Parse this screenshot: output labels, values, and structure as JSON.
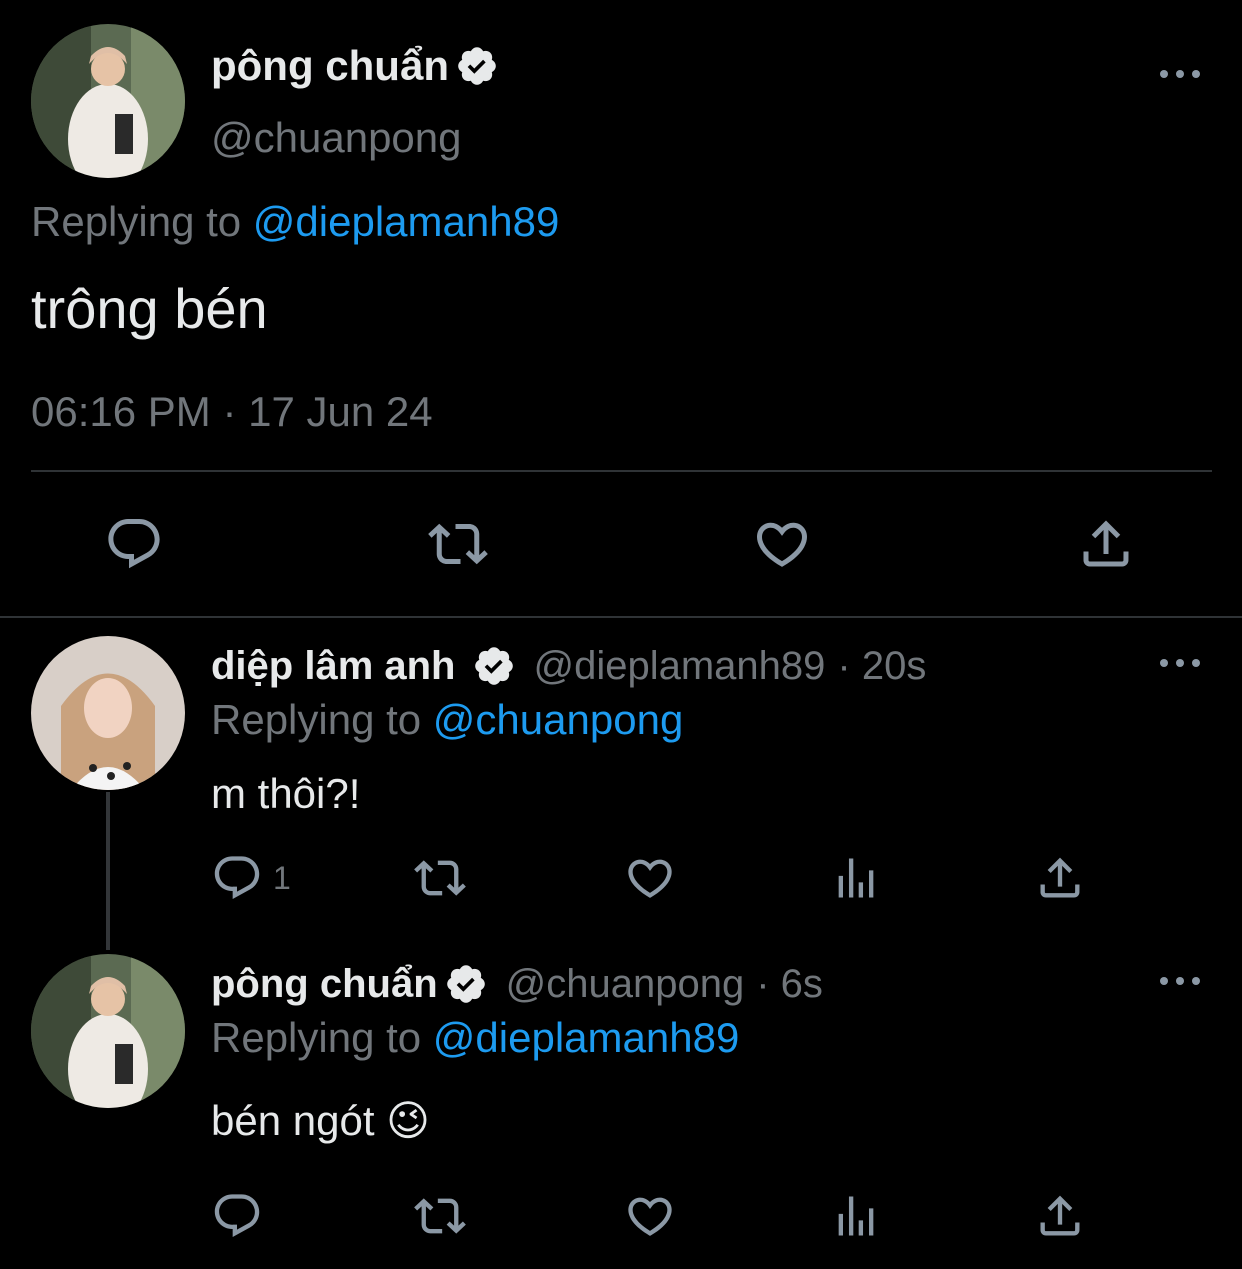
{
  "colors": {
    "background": "#000000",
    "text": "#e7e9ea",
    "muted": "#71767b",
    "link": "#1d9bf0",
    "icon": "#8b98a5"
  },
  "main_tweet": {
    "display_name": "pông chuẩn",
    "handle": "@chuanpong",
    "replying_prefix": "Replying to",
    "replying_to": "@dieplamanh89",
    "text": "trông bén",
    "timestamp": "06:16 PM · 17 Jun 24",
    "actions": [
      "reply-icon",
      "retweet-icon",
      "like-icon",
      "share-icon"
    ]
  },
  "replies": [
    {
      "display_name": "diệp lâm anh",
      "handle": "@dieplamanh89",
      "time": "· 20s",
      "replying_prefix": "Replying to",
      "replying_to": "@chuanpong",
      "text": "m thôi?!",
      "reply_count": "1",
      "actions": [
        "reply-icon",
        "retweet-icon",
        "like-icon",
        "analytics-icon",
        "share-icon"
      ]
    },
    {
      "display_name": "pông chuẩn",
      "handle": "@chuanpong",
      "time": "· 6s",
      "replying_prefix": "Replying to",
      "replying_to": "@dieplamanh89",
      "text": "bén ngót 😉",
      "actions": [
        "reply-icon",
        "retweet-icon",
        "like-icon",
        "analytics-icon",
        "share-icon"
      ]
    }
  ]
}
